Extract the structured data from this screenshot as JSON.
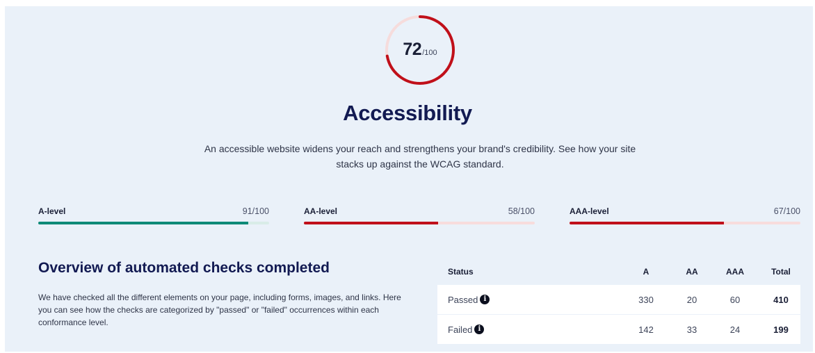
{
  "score": {
    "value": "72",
    "max": "/100",
    "fraction": 0.72,
    "color": "#c0101a"
  },
  "header": {
    "title": "Accessibility",
    "description": "An accessible website widens your reach and strengthens your brand's credibility. See how your site stacks up against the WCAG standard."
  },
  "levels": [
    {
      "name": "A-level",
      "score": "91/100",
      "fraction": 0.91,
      "color": "#0e8a78"
    },
    {
      "name": "AA-level",
      "score": "58/100",
      "fraction": 0.58,
      "color": "#c0101a"
    },
    {
      "name": "AAA-level",
      "score": "67/100",
      "fraction": 0.67,
      "color": "#c0101a"
    }
  ],
  "overview": {
    "title": "Overview of automated checks completed",
    "description": "We have checked all the different elements on your page, including forms, images, and links. Here you can see how the checks are categorized by \"passed\" or \"failed\" occurrences within each conformance level."
  },
  "table": {
    "headers": {
      "status": "Status",
      "a": "A",
      "aa": "AA",
      "aaa": "AAA",
      "total": "Total"
    },
    "rows": [
      {
        "status": "Passed",
        "icon": "info-icon",
        "a": "330",
        "aa": "20",
        "aaa": "60",
        "total": "410"
      },
      {
        "status": "Failed",
        "icon": "info-icon",
        "a": "142",
        "aa": "33",
        "aaa": "24",
        "total": "199"
      }
    ]
  }
}
